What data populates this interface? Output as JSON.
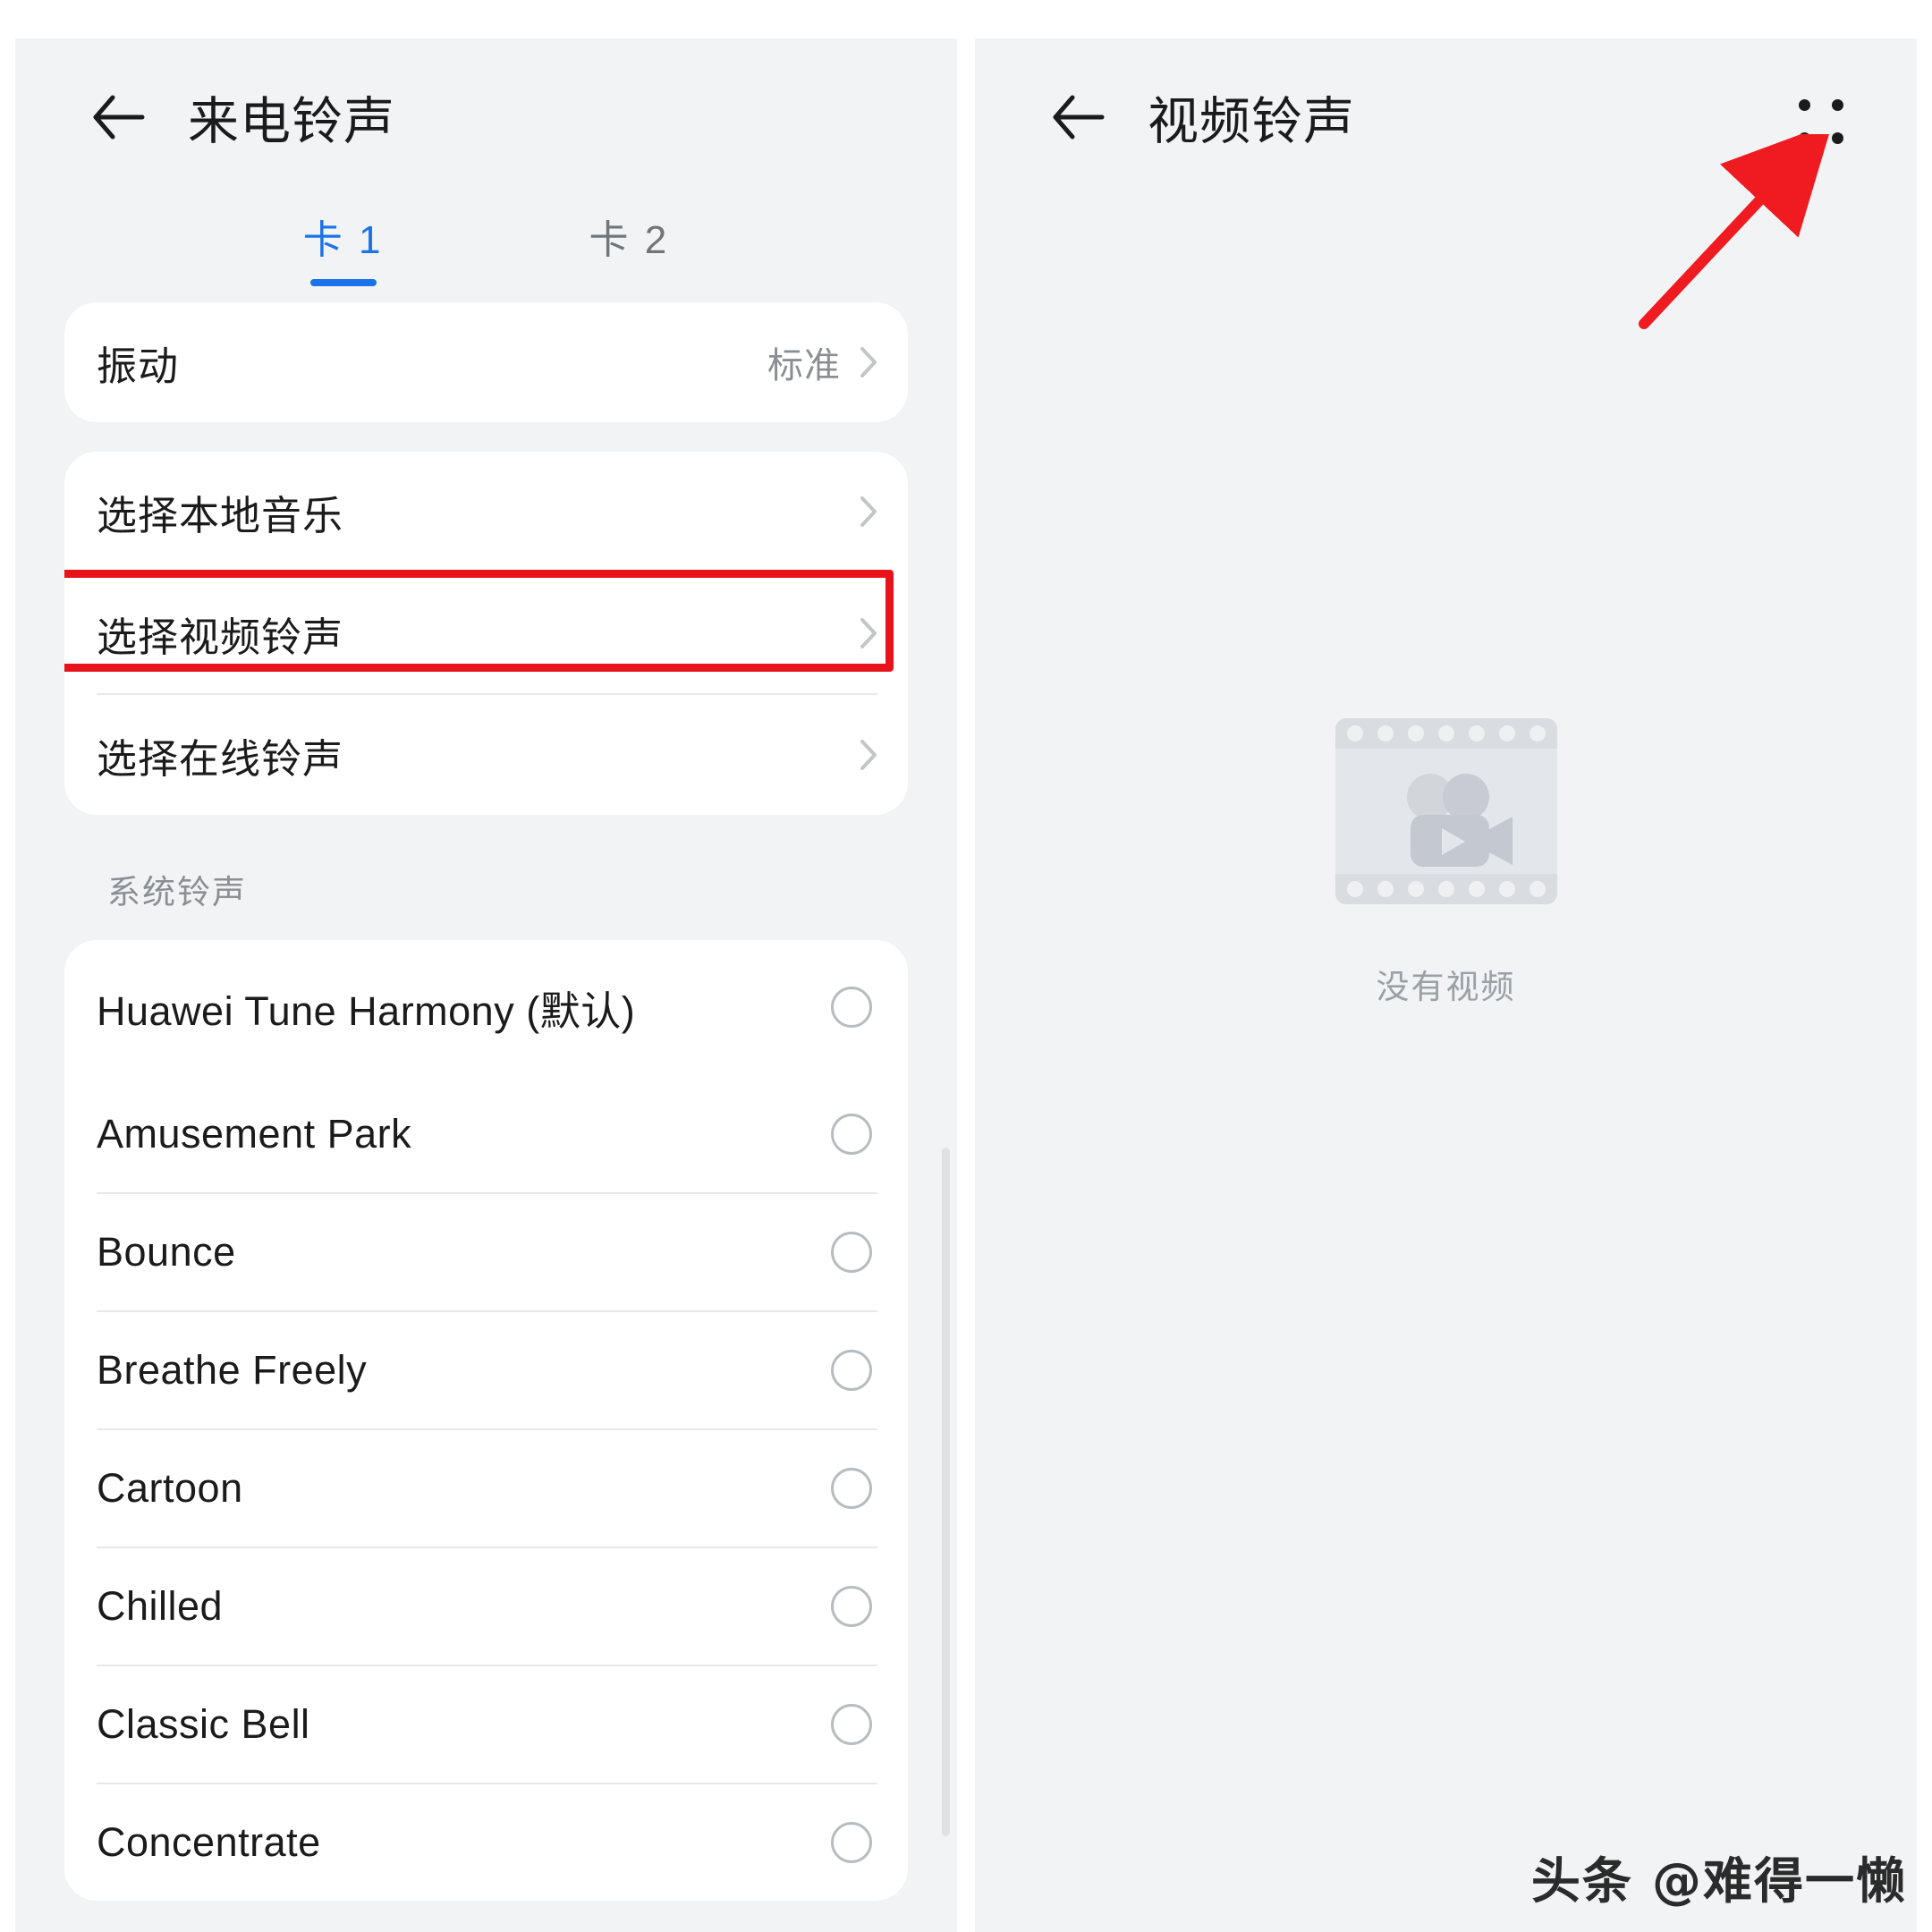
{
  "left_panel": {
    "header": {
      "back_icon": "back-arrow-icon",
      "title": "来电铃声"
    },
    "tabs": [
      {
        "label": "卡 1",
        "active": true
      },
      {
        "label": "卡 2",
        "active": false
      }
    ],
    "vibration": {
      "label": "振动",
      "value": "标准",
      "chevron_icon": "chevron-right-icon"
    },
    "source_rows": [
      {
        "label": "选择本地音乐",
        "chevron_icon": "chevron-right-icon",
        "highlighted": false
      },
      {
        "label": "选择视频铃声",
        "chevron_icon": "chevron-right-icon",
        "highlighted": true
      },
      {
        "label": "选择在线铃声",
        "chevron_icon": "chevron-right-icon",
        "highlighted": false
      }
    ],
    "section_title": "系统铃声",
    "ringtones": [
      {
        "name": "Huawei Tune Harmony (默认)",
        "selected": false
      },
      {
        "name": "Amusement Park",
        "selected": false
      },
      {
        "name": "Bounce",
        "selected": false
      },
      {
        "name": "Breathe Freely",
        "selected": false
      },
      {
        "name": "Cartoon",
        "selected": false
      },
      {
        "name": "Chilled",
        "selected": false
      },
      {
        "name": "Classic Bell",
        "selected": false
      },
      {
        "name": "Concentrate",
        "selected": false
      }
    ]
  },
  "right_panel": {
    "header": {
      "back_icon": "back-arrow-icon",
      "title": "视频铃声",
      "menu_icon": "grid-menu-icon"
    },
    "empty_state": {
      "placeholder_icon": "video-film-placeholder-icon",
      "text": "没有视频"
    }
  },
  "annotations": {
    "arrow_icon": "red-arrow-annotation",
    "highlight_color": "#e8131a"
  },
  "watermark": "头条 @难得一懒",
  "colors": {
    "accent": "#1a73e8",
    "panel_bg": "#f1f3f4",
    "card_bg": "#ffffff",
    "text_primary": "#1b1b1b",
    "text_secondary": "#8b8f94",
    "annotation_red": "#e8131a"
  }
}
